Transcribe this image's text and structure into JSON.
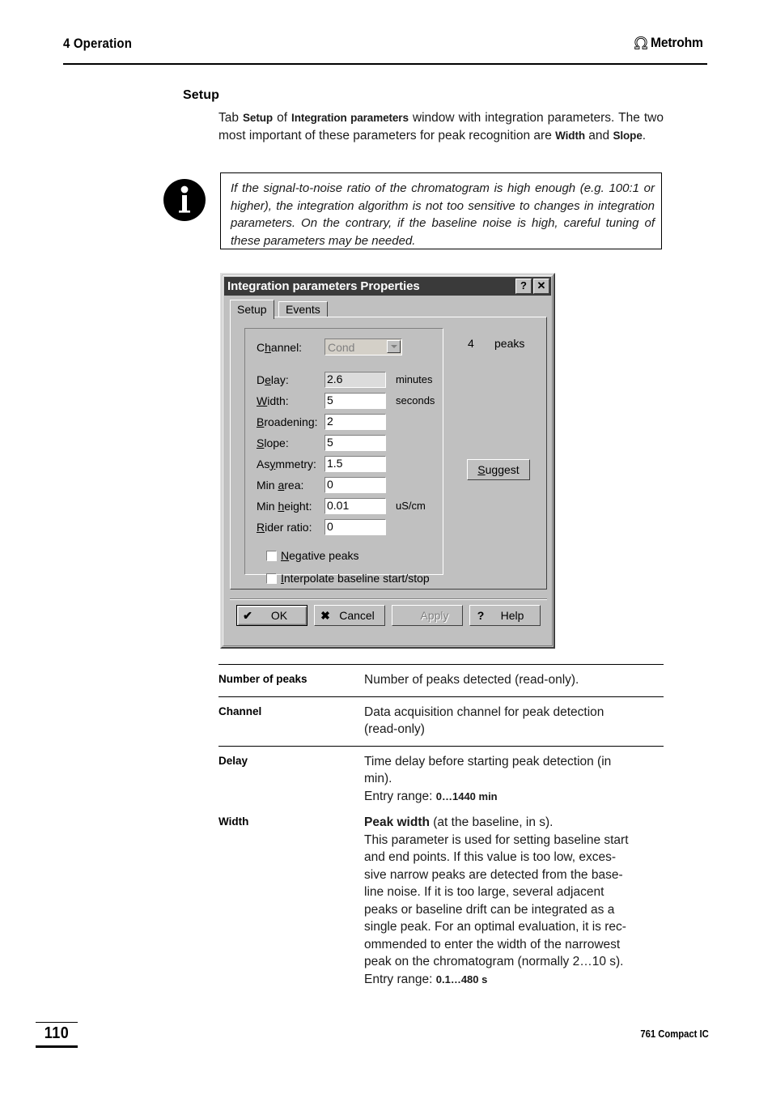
{
  "header": {
    "chapter": "4 Operation",
    "brand": "Metrohm"
  },
  "section": {
    "title": "Setup",
    "intro_before": "Tab ",
    "intro_b1": "Setup",
    "intro_mid1": " of ",
    "intro_b2": "Integration parameters",
    "intro_mid2": " window with integration parameters. The two most important of these parameters for peak recognition are ",
    "intro_b3": "Width",
    "intro_mid3": " and ",
    "intro_b4": "Slope",
    "intro_end": "."
  },
  "note": {
    "icon": "info-icon",
    "text": "If the signal-to-noise ratio of the chromatogram is high enough (e.g. 100:1 or higher), the integration algorithm is not too sensitive to changes in integration parameters. On the contrary, if the baseline noise is high, careful tuning of these parameters may be needed."
  },
  "dialog": {
    "title": "Integration parameters Properties",
    "titlebar_buttons": [
      {
        "name": "help-button",
        "glyph": "?"
      },
      {
        "name": "close-button",
        "glyph": "✕"
      }
    ],
    "tabs": [
      {
        "label": "Setup",
        "active": true
      },
      {
        "label": "Events",
        "active": false
      }
    ],
    "channel": {
      "label_pre": "C",
      "label_key": "h",
      "label_post": "annel:",
      "value": "Cond"
    },
    "fields": [
      {
        "label_pre": "D",
        "label_key": "e",
        "label_post": "lay:",
        "value": "2.6",
        "unit": "minutes",
        "focused": true
      },
      {
        "label_pre": "",
        "label_key": "W",
        "label_post": "idth:",
        "value": "5",
        "unit": "seconds",
        "focused": false
      },
      {
        "label_pre": "",
        "label_key": "B",
        "label_post": "roadening:",
        "value": "2",
        "unit": "",
        "focused": false
      },
      {
        "label_pre": "",
        "label_key": "S",
        "label_post": "lope:",
        "value": "5",
        "unit": "",
        "focused": false
      },
      {
        "label_pre": "As",
        "label_key": "y",
        "label_post": "mmetry:",
        "value": "1.5",
        "unit": "",
        "focused": false
      },
      {
        "label_pre": "Min ",
        "label_key": "a",
        "label_post": "rea:",
        "value": "0",
        "unit": "",
        "focused": false
      },
      {
        "label_pre": "Min ",
        "label_key": "h",
        "label_post": "eight:",
        "value": "0.01",
        "unit": "uS/cm",
        "focused": false
      },
      {
        "label_pre": "",
        "label_key": "R",
        "label_post": "ider ratio:",
        "value": "0",
        "unit": "",
        "focused": false
      }
    ],
    "checkboxes": [
      {
        "label_pre": "",
        "label_key": "N",
        "label_post": "egative peaks",
        "checked": false
      },
      {
        "label_pre": "",
        "label_key": "I",
        "label_post": "nterpolate baseline start/stop",
        "checked": false
      }
    ],
    "peaks": {
      "count": "4",
      "label": "peaks"
    },
    "suggest": {
      "label_key": "S",
      "label_post": "uggest"
    },
    "buttons": [
      {
        "name": "ok-button",
        "glyph": "✔",
        "label": "OK",
        "disabled": false,
        "default": true
      },
      {
        "name": "cancel-button",
        "glyph": "✖",
        "label": "Cancel",
        "disabled": false,
        "default": false
      },
      {
        "name": "apply-button",
        "glyph": "",
        "label": "Apply",
        "disabled": true,
        "default": false
      },
      {
        "name": "help-button",
        "glyph": "?",
        "label": "Help",
        "disabled": false,
        "default": false
      }
    ]
  },
  "definitions": [
    {
      "term": "Number of peaks",
      "lines": [
        {
          "text": "Number of peaks detected (read-only)."
        }
      ],
      "rule_before": true
    },
    {
      "term": "Channel",
      "lines": [
        {
          "text": "Data acquisition channel for peak detection"
        },
        {
          "text": "(read-only)"
        }
      ],
      "rule_before": true
    },
    {
      "term": "Delay",
      "lines": [
        {
          "text": "Time delay before starting peak detection (in"
        },
        {
          "text": "min)."
        },
        {
          "text": "Entry range:  ",
          "range": "0…1440 min"
        }
      ],
      "rule_before": true
    },
    {
      "term": "Width",
      "lines": [
        {
          "strong": "Peak width",
          "text": " (at the baseline, in s)."
        },
        {
          "text": "This parameter is used for setting baseline start"
        },
        {
          "text": "and end points. If this value is too low, exces-"
        },
        {
          "text": "sive narrow peaks are detected from the base-"
        },
        {
          "text": "line noise. If it is too large, several adjacent"
        },
        {
          "text": "peaks or baseline drift can be integrated as a"
        },
        {
          "text": "single peak. For an optimal evaluation, it is rec-"
        },
        {
          "text": "ommended to enter the width of the narrowest"
        },
        {
          "text": "peak on the chromatogram (normally 2…10 s)."
        },
        {
          "text": "Entry range:  ",
          "range": "0.1…480 s"
        }
      ],
      "rule_before": false
    }
  ],
  "footer": {
    "page_number": "110",
    "doc_title": "761 Compact IC"
  }
}
